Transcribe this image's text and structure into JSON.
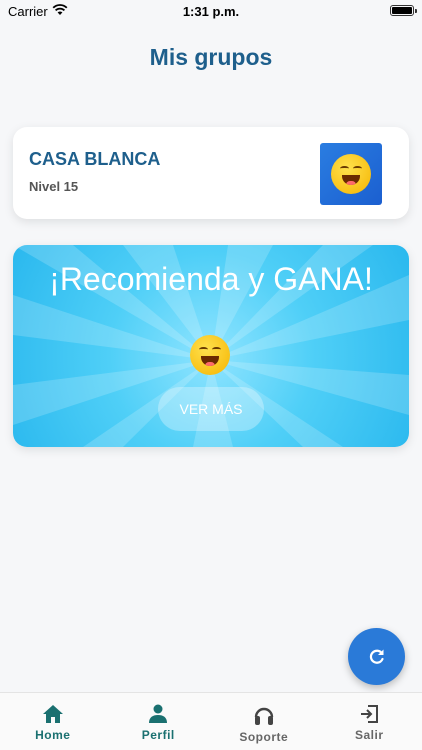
{
  "status_bar": {
    "carrier": "Carrier",
    "time": "1:31 p.m."
  },
  "page": {
    "title": "Mis grupos"
  },
  "group_card": {
    "name": "CASA BLANCA",
    "level": "Nivel 15",
    "thumb_icon": "smiling-emoji-icon"
  },
  "promo": {
    "headline": "¡Recomienda y GANA!",
    "button_label": "VER MÁS",
    "emoji_icon": "smiling-emoji-icon"
  },
  "fab": {
    "icon": "refresh-icon",
    "color": "#2a7ad8"
  },
  "nav": {
    "items": [
      {
        "label": "Home",
        "icon": "home-icon"
      },
      {
        "label": "Perfil",
        "icon": "person-icon"
      },
      {
        "label": "Soporte",
        "icon": "headset-icon"
      },
      {
        "label": "Salir",
        "icon": "logout-icon"
      }
    ]
  },
  "colors": {
    "title": "#1e5f8c",
    "nav_active": "#1a7070",
    "nav_inactive": "#666666"
  }
}
